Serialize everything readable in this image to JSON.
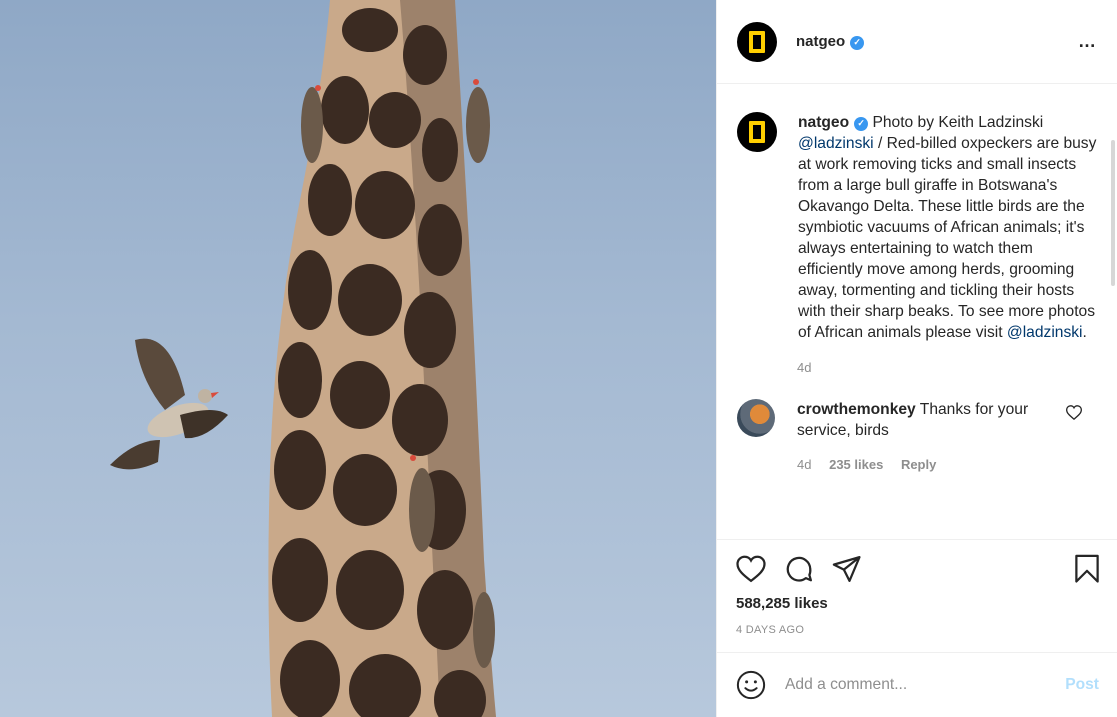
{
  "post": {
    "username": "natgeo",
    "more_icon": "…"
  },
  "caption": {
    "username": "natgeo",
    "text_1": "Photo by Keith Ladzinski ",
    "mention_1": "@ladzinski",
    "text_2": " / Red-billed oxpeckers are busy at work removing ticks and small insects from a large bull giraffe in Botswana's Okavango Delta. These little birds are the symbiotic vacuums of African animals; it's always entertaining to watch them efficiently move among herds, grooming away, tormenting and tickling their hosts with their sharp beaks. To see more photos of African animals please visit ",
    "mention_2": "@ladzinski",
    "text_3": ".",
    "time": "4d"
  },
  "comment": {
    "username": "crowthemonkey",
    "text": "Thanks for your service, birds",
    "time": "4d",
    "likes": "235 likes",
    "reply": "Reply"
  },
  "actions": {
    "likes": "588,285 likes",
    "time_ago": "4 DAYS AGO"
  },
  "add_comment": {
    "placeholder": "Add a comment...",
    "post_label": "Post"
  },
  "colors": {
    "accent": "#3897f0",
    "brand_yellow": "#ffcf00",
    "link": "#00376b",
    "post_disabled": "#b2dffc"
  }
}
